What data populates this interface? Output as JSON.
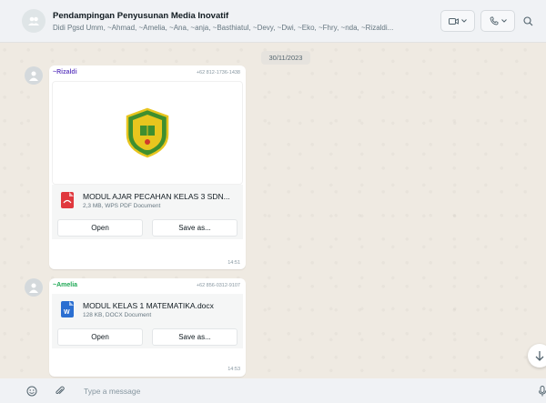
{
  "header": {
    "title": "Pendampingan Penyusunan Media Inovatif",
    "participants": "Didi Pgsd Umm, ~Ahmad, ~Amelia, ~Ana, ~anja, ~Basthiatul, ~Devy, ~Dwi, ~Eko, ~Fhry, ~nda, ~Rizaldi..."
  },
  "chat": {
    "date": "30/11/2023",
    "messages": [
      {
        "sender": "~Rizaldi",
        "sender_color": "#6a4bc4",
        "phone": "+62 812-1736-1438",
        "file_name": "MODUL AJAR PECAHAN KELAS 3 SDN...",
        "file_info": "2,3 MB, WPS PDF Document",
        "file_type_icon": "pdf-document-icon",
        "open_label": "Open",
        "save_label": "Save as...",
        "time": "14:51"
      },
      {
        "sender": "~Amelia",
        "sender_color": "#1fa855",
        "phone": "+62 856-0312-9107",
        "file_name": "MODUL KELAS 1 MATEMATIKA.docx",
        "file_info": "128 KB, DOCX Document",
        "file_type_icon": "word-document-icon",
        "open_label": "Open",
        "save_label": "Save as...",
        "time": "14:53"
      }
    ]
  },
  "footer": {
    "placeholder": "Type a message"
  },
  "colors": {
    "pdf_icon": "#e0383e",
    "word_icon": "#2b6fd1",
    "logo_green": "#3f8f2f",
    "logo_yellow": "#e8c51e"
  }
}
